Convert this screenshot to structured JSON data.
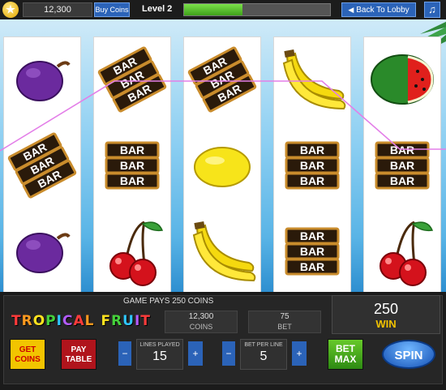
{
  "topbar": {
    "star_glyph": "★",
    "coins": "12,300",
    "buy_coins_label": "Buy Coins",
    "level_label": "Level 2",
    "level_progress": 0.4,
    "back_to_lobby_label": "Back To Lobby",
    "back_arrow_glyph": "◀",
    "music_glyph": "♫"
  },
  "reels": [
    [
      "plum",
      "bar3",
      "plum"
    ],
    [
      "bar3",
      "bar3",
      "cherry"
    ],
    [
      "bar3",
      "lemon",
      "banana"
    ],
    [
      "banana",
      "bar3",
      "bar3"
    ],
    [
      "watermelon",
      "bar3",
      "cherry"
    ]
  ],
  "bar_text": "BAR",
  "payline_color": "#e37ee8",
  "panel": {
    "game_pays": "GAME PAYS 250 COINS",
    "logo_text": "TROPICAL FRUIT",
    "coins_value": "12,300",
    "coins_label": "COINS",
    "bet_value": "75",
    "bet_label": "BET",
    "win_value": "250",
    "win_label": "WIN",
    "get_coins_line1": "GET",
    "get_coins_line2": "COINS",
    "pay_table_line1": "PAY",
    "pay_table_line2": "TABLE",
    "lines_played_label": "LINES PLAYED",
    "lines_played_value": "15",
    "bet_per_line_label": "BET PER LINE",
    "bet_per_line_value": "5",
    "bet_max_line1": "BET",
    "bet_max_line2": "MAX",
    "spin_label": "SPIN",
    "minus_glyph": "−",
    "plus_glyph": "+"
  },
  "colors": {
    "accent_blue": "#2b63b8",
    "win_gold": "#f2c200",
    "progress_green": "#5cc130"
  }
}
